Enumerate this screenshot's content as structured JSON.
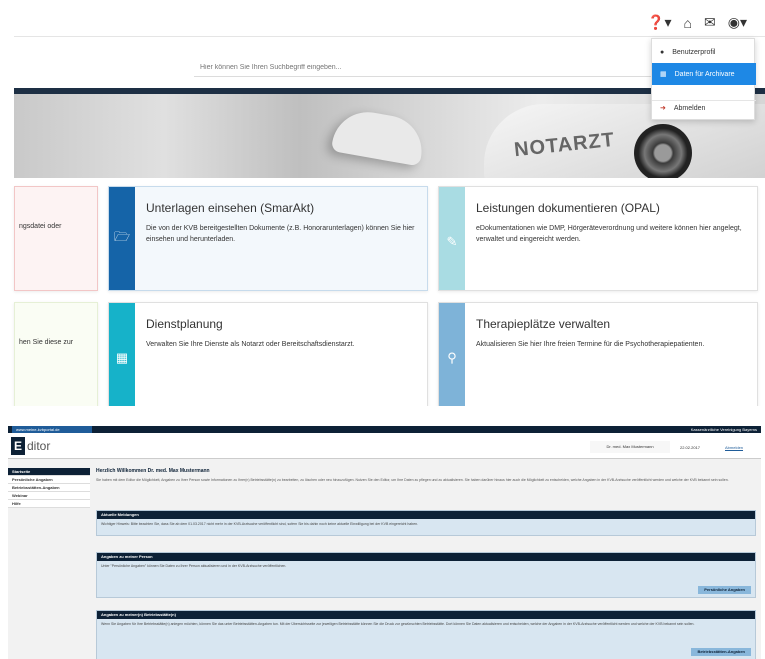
{
  "top": {
    "icons": {
      "help": "help-icon",
      "home": "home-icon",
      "mail": "mail-icon",
      "user": "user-icon"
    },
    "search_placeholder": "Hier können Sie Ihren Suchbegriff eingeben...",
    "hero_text": "NOTARZT",
    "dropdown": {
      "items": [
        {
          "label": "Benutzerprofil",
          "icon": "user-icon"
        },
        {
          "label": "Daten für Archivare",
          "icon": "card-icon",
          "active": true
        },
        {
          "label": "Abmelden",
          "icon": "logout-icon"
        }
      ]
    },
    "cards": [
      {
        "title": "",
        "desc": "ngsdatei oder"
      },
      {
        "title": "Unterlagen einsehen (SmarAkt)",
        "desc": "Die von der KVB bereitgestellten Dokumente (z.B. Honorarunterlagen) können Sie hier einsehen und herunterladen.",
        "color": "#1564a8",
        "icon": "folder-icon"
      },
      {
        "title": "Leistungen dokumentieren (OPAL)",
        "desc": "eDokumentationen wie DMP, Hörgeräteverordnung und weitere können hier angelegt, verwaltet und eingereicht werden.",
        "color": "#a9dce3",
        "icon": "edit-icon"
      },
      {
        "title": "",
        "desc": "hen Sie diese zur"
      },
      {
        "title": "Dienstplanung",
        "desc": "Verwalten Sie Ihre Dienste als Notarzt oder Bereitschaftsdienstarzt.",
        "color": "#16b2c9",
        "icon": "calendar-icon"
      },
      {
        "title": "Therapieplätze verwalten",
        "desc": "Aktualisieren Sie hier Ihre freien Termine für die Psychotherapiepatienten.",
        "color": "#7eb3d8",
        "icon": "location-icon"
      }
    ]
  },
  "bottom": {
    "strip_left": "www.meine-kvbportal.de",
    "strip_right": "Kassenärztliche Vereinigung Bayerns",
    "logo_letter": "E",
    "logo_text": "ditor",
    "user_name": "Dr. med. Max Mustermann",
    "date": "22.02.2017",
    "logout": "Abmelden",
    "sidebar": [
      {
        "label": "Startseite",
        "active": true
      },
      {
        "label": "Persönliche Angaben"
      },
      {
        "label": "Betriebsstätten-Angaben"
      },
      {
        "label": "Webinar"
      },
      {
        "label": "Hilfe"
      }
    ],
    "welcome": "Herzlich Willkommen Dr. med.  Max Mustermann",
    "intro": "Sie haben mit dem Editor die Möglichkeit, Angaben zu Ihrer Person sowie Informationen zu Ihrer(n) Betriebsstätte(n) zu bearbeiten, zu löschen oder neu hinzuzufügen. Nutzen Sie den Editor, um Ihre Daten zu pflegen und zu aktualisieren. Sie haben darüber hinaus hier auch die Möglichkeit zu entscheiden, welche Angaben in der KVB-Arztsuche veröffentlicht werden und welche der KVB bekannt sein sollen.",
    "boxes": [
      {
        "title": "Aktuelle Meldungen",
        "text": "Wichtiger Hinweis: Bitte beachten Sie, dass Sie ab dem 01.03.2017 nicht mehr in der KVB-Arztsuche veröffentlicht sind, sofern Sie bis dahin noch keine aktuelle Einwilligung bei der KVB eingereicht haben.",
        "button": ""
      },
      {
        "title": "Angaben zu meiner Person",
        "text": "Unter \"Persönliche Angaben\" können Sie Daten zu Ihrer Person aktualisieren und in der KVB-Arztsuche veröffentlichen.",
        "button": "Persönliche Angaben"
      },
      {
        "title": "Angaben zu meiner(n) Betriebsstätte(n)",
        "text": "Wenn Sie Angaben für Ihre Betriebsstätte(n) anlegen möchten, können Sie das unter Betriebsstätten-Angaben tun. Mit der Übersichtsseite zur jeweiligen Betriebsstätte können Sie die Druck zur gewünschten Betriebsstätte. Dort können Sie Daten aktualisieren und entscheiden, welche der Angaben in der KVB-Arztsuche veröffentlicht werden und welche der KVB bekannt sein sollen.",
        "button": "Betriebsstätten-Angaben"
      }
    ]
  }
}
